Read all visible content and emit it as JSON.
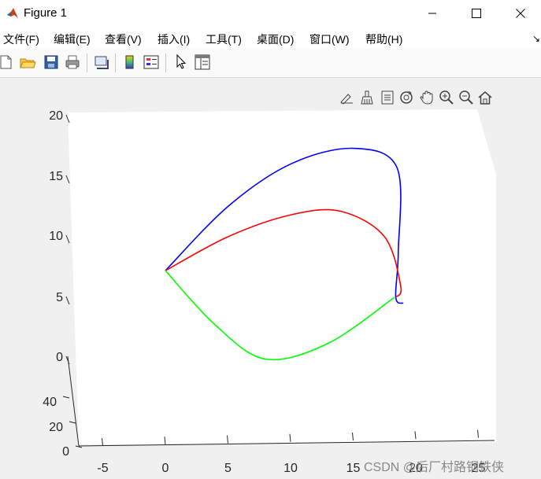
{
  "window": {
    "title": "Figure 1",
    "controls": [
      "minimize",
      "maximize",
      "close"
    ]
  },
  "menu": [
    "文件(F)",
    "编辑(E)",
    "查看(V)",
    "插入(I)",
    "工具(T)",
    "桌面(D)",
    "窗口(W)",
    "帮助(H)"
  ],
  "toolbar": {
    "icons": [
      "new-figure-icon",
      "open-file-icon",
      "save-icon",
      "print-icon",
      "link-plot-icon",
      "insert-colorbar-icon",
      "insert-legend-icon",
      "edit-plot-icon",
      "property-inspector-icon"
    ]
  },
  "axes_toolbar": {
    "icons": [
      "data-tips-icon",
      "brush-icon",
      "export-icon",
      "rotate-3d-icon",
      "pan-icon",
      "zoom-in-icon",
      "zoom-out-icon",
      "home-icon"
    ]
  },
  "chart_data": {
    "type": "line",
    "view": "3d",
    "xlim": [
      -7,
      27
    ],
    "ylim": [
      0,
      50
    ],
    "zlim": [
      0,
      20
    ],
    "x_ticks": [
      "-5",
      "0",
      "5",
      "10",
      "15",
      "20",
      "25"
    ],
    "y_ticks": [
      "0",
      "20",
      "40"
    ],
    "z_ticks": [
      "0",
      "5",
      "10",
      "15",
      "20"
    ],
    "grid": false,
    "series": [
      {
        "color": "#0000ff",
        "approx_path": [
          [
            0,
            3.5
          ],
          [
            5,
            8.8
          ],
          [
            10,
            12.3
          ],
          [
            15,
            13.6
          ],
          [
            18.5,
            12
          ],
          [
            18.6,
            5
          ],
          [
            18.4,
            1.3
          ],
          [
            19,
            0.8
          ]
        ]
      },
      {
        "color": "#ff0000",
        "approx_path": [
          [
            0,
            3.5
          ],
          [
            5,
            6.3
          ],
          [
            10,
            8.1
          ],
          [
            14,
            8.4
          ],
          [
            17.5,
            6.3
          ],
          [
            18.8,
            2.2
          ],
          [
            18.4,
            1.3
          ]
        ]
      },
      {
        "color": "#00ff00",
        "approx_path": [
          [
            0,
            3.5
          ],
          [
            4,
            -1
          ],
          [
            8,
            -3.8
          ],
          [
            13,
            -2.5
          ],
          [
            18.3,
            1.3
          ]
        ]
      }
    ]
  },
  "watermark": "CSDN @后厂村路钢铁侠"
}
